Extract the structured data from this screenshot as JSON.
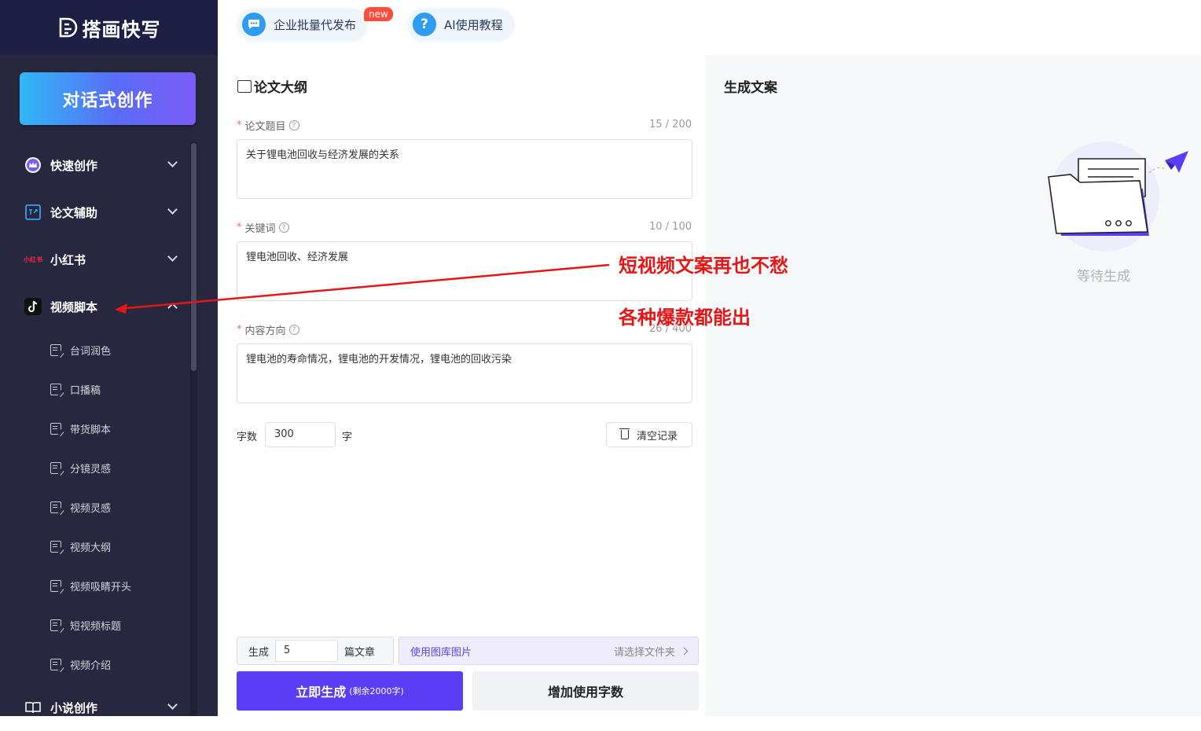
{
  "brand": {
    "name": "搭画快写"
  },
  "cta": {
    "label": "对话式创作"
  },
  "sidebar": {
    "groups": [
      {
        "label": "快速创作",
        "icon": "crown-icon"
      },
      {
        "label": "论文辅助",
        "icon": "paper-assist-icon"
      },
      {
        "label": "小红书",
        "icon": "xiaohongshu-icon",
        "icon_text": "小红书"
      },
      {
        "label": "视频脚本",
        "icon": "tiktok-icon"
      }
    ],
    "items": [
      "台词润色",
      "口播稿",
      "带货脚本",
      "分镜灵感",
      "视频灵感",
      "视频大纲",
      "视频吸睛开头",
      "短视频标题",
      "视频介绍"
    ],
    "last_group": {
      "label": "小说创作",
      "icon": "book-icon"
    }
  },
  "topbar": {
    "enterprise_label": "企业批量代发布",
    "badge": "new",
    "tutorial_label": "AI使用教程",
    "tutorial_icon_text": "?"
  },
  "form": {
    "title": "论文大纲",
    "topic": {
      "label": "论文题目",
      "counter": "15 / 200",
      "value": "关于锂电池回收与经济发展的关系"
    },
    "keywords": {
      "label": "关键词",
      "counter": "10 / 100",
      "value": "锂电池回收、经济发展"
    },
    "direction": {
      "label": "内容方向",
      "counter": "26 / 400",
      "value": "锂电池的寿命情况，锂电池的开发情况，锂电池的回收污染"
    },
    "word_count": {
      "label": "字数",
      "value": "300",
      "unit": "字"
    },
    "clear_label": "清空记录",
    "generate": {
      "prefix": "生成",
      "value": "5",
      "suffix": "篇文章"
    },
    "gallery": {
      "label": "使用图库图片",
      "placeholder": "请选择文件夹"
    },
    "primary": {
      "label": "立即生成",
      "sub": "(剩余2000字)"
    },
    "secondary": {
      "label": "增加使用字数"
    },
    "required_mark": "*",
    "help_mark": "?"
  },
  "result": {
    "title": "生成文案",
    "waiting": "等待生成"
  },
  "annotations": {
    "line1": "短视频文案再也不愁",
    "line2": "各种爆款都能出",
    "color": "#e51616"
  }
}
